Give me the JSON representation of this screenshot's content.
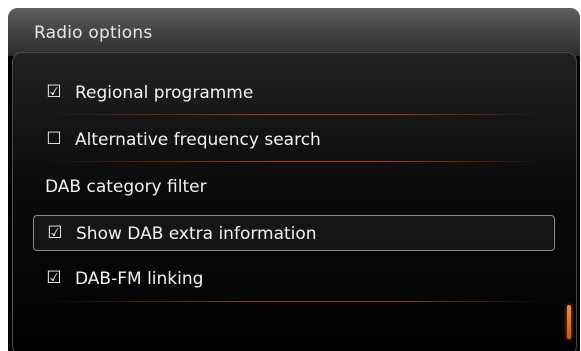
{
  "header": {
    "title": "Radio options"
  },
  "menu": {
    "items": [
      {
        "label": "Regional programme",
        "check": "☑",
        "checked": true
      },
      {
        "label": "Alternative frequency search",
        "check": "☐",
        "checked": false
      },
      {
        "label": "DAB category filter"
      },
      {
        "label": "Show DAB extra information",
        "check": "☑",
        "checked": true,
        "selected": true
      },
      {
        "label": "DAB-FM linking",
        "check": "☑",
        "checked": true
      }
    ]
  },
  "colors": {
    "accent": "#d2600a",
    "background": "#000000",
    "text": "#f2f2f2"
  }
}
